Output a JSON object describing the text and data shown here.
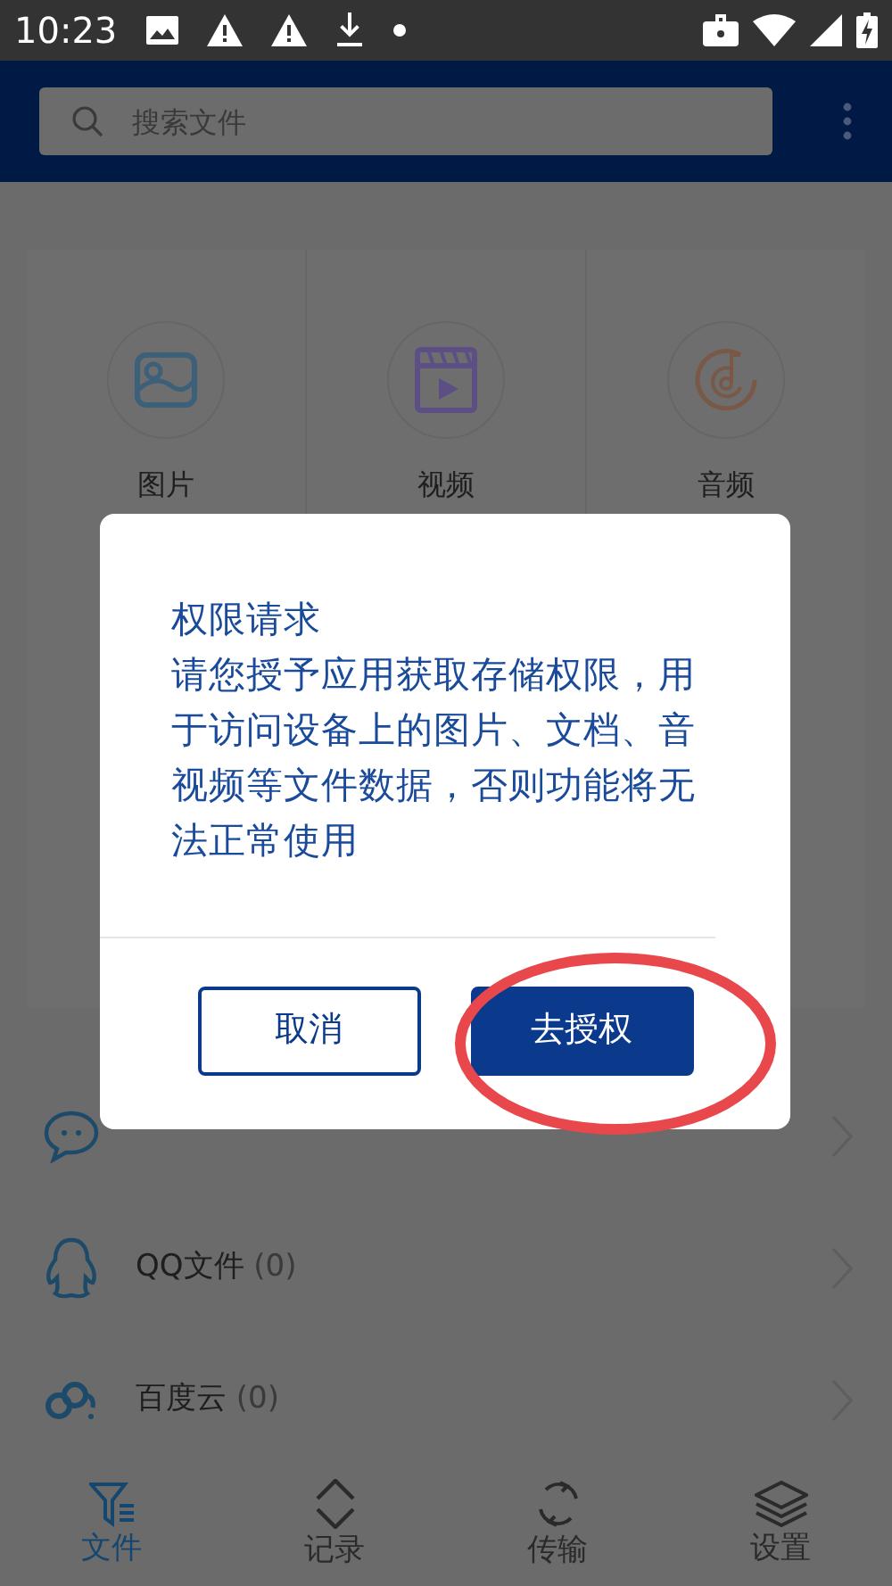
{
  "status_bar": {
    "time": "10:23"
  },
  "search": {
    "placeholder": "搜索文件"
  },
  "categories": [
    {
      "label": "图片",
      "kind": "image"
    },
    {
      "label": "视频",
      "kind": "video"
    },
    {
      "label": "音频",
      "kind": "audio"
    }
  ],
  "sources": [
    {
      "kind": "chat"
    },
    {
      "label": "QQ文件",
      "count": "(0)",
      "kind": "penguin"
    },
    {
      "label": "百度云",
      "count": "(0)",
      "kind": "cloud"
    }
  ],
  "bottom_nav": [
    {
      "label": "文件",
      "kind": "files",
      "selected": true
    },
    {
      "label": "记录",
      "kind": "record",
      "selected": false
    },
    {
      "label": "传输",
      "kind": "transfer",
      "selected": false
    },
    {
      "label": "设置",
      "kind": "settings",
      "selected": false
    }
  ],
  "dialog": {
    "title": "权限请求",
    "message": "请您授予应用获取存储权限，用于访问设备上的图片、文档、音视频等文件数据，否则功能将无法正常使用",
    "buttons": [
      {
        "label": "取消",
        "kind": "secondary",
        "circled": false
      },
      {
        "label": "去授权",
        "kind": "primary",
        "circled": true
      }
    ]
  }
}
